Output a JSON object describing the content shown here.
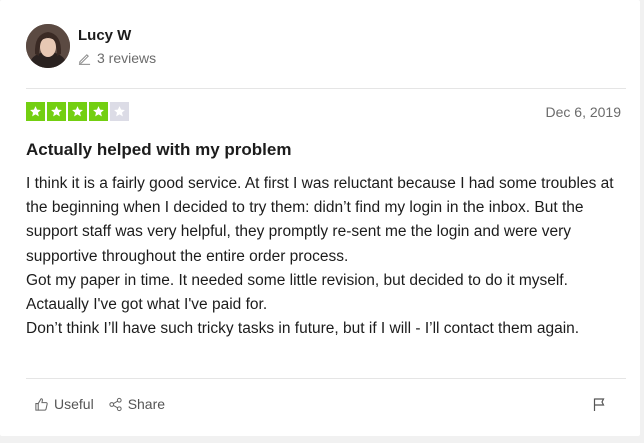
{
  "reviewer": {
    "name": "Lucy W",
    "reviews_count": "3 reviews"
  },
  "rating": {
    "value": 4,
    "max": 5,
    "filled_color": "#73cf11",
    "empty_color": "#dcdce6"
  },
  "review": {
    "date": "Dec 6, 2019",
    "title": "Actually helped with my problem",
    "paragraphs": [
      "I think it is a fairly good service. At first I was reluctant because I had some troubles at the beginning when I decided to try them: didn’t find my login in the inbox. But the support staff was very helpful, they promptly re-sent me the login and were very supportive throughout the entire order process.",
      "Got my paper in time. It needed some little revision, but decided to do it myself. Actaually I've got what I've paid for.",
      "Don’t think I’ll have such tricky tasks in future, but if I will - I’ll contact them again."
    ]
  },
  "actions": {
    "useful_label": "Useful",
    "share_label": "Share",
    "useful_icon": "thumbs-up-icon",
    "share_icon": "share-icon",
    "flag_icon": "flag-icon"
  }
}
